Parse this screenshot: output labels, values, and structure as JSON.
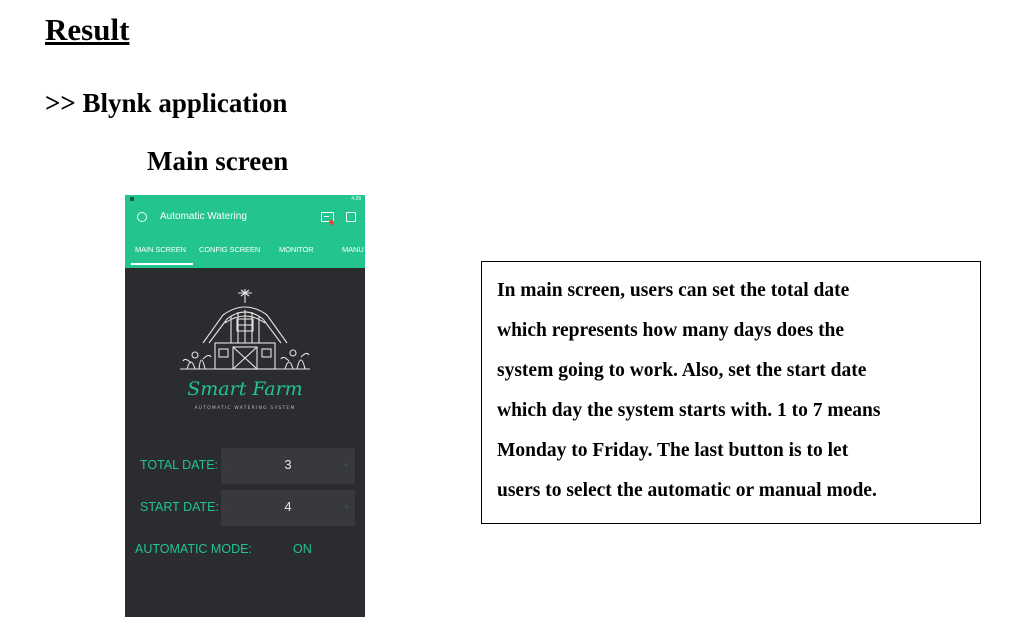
{
  "document": {
    "heading": "Result",
    "subheading": ">> Blynk application",
    "caption": "Main screen"
  },
  "phone": {
    "app_title": "Automatic Watering",
    "status_time": "4:28",
    "tabs": [
      {
        "label": "MAIN SCREEN",
        "active": true
      },
      {
        "label": "CONFIG SCREEN",
        "active": false
      },
      {
        "label": "MONITOR",
        "active": false
      },
      {
        "label": "MANU",
        "active": false
      }
    ],
    "logo": {
      "script_text": "Smart Farm",
      "tagline": "AUTOMATIC WATERING SYSTEM"
    },
    "fields": [
      {
        "label": "TOTAL DATE:",
        "value": "3",
        "minus": "-",
        "plus": "+"
      },
      {
        "label": "START DATE:",
        "value": "4",
        "minus": "-",
        "plus": "+"
      }
    ],
    "mode": {
      "label": "AUTOMATIC MODE:",
      "value": "ON"
    },
    "colors": {
      "accent": "#23c48e",
      "background": "#2b2c2f",
      "widget": "#37393d"
    }
  },
  "description": {
    "lines": [
      "In main screen, users can set the total date",
      "which represents how many days does the",
      "system going to work. Also, set the start date",
      "which day the system starts with. 1 to 7 means",
      "Monday to Friday. The last button is to let",
      "users to select the automatic or manual mode."
    ]
  }
}
